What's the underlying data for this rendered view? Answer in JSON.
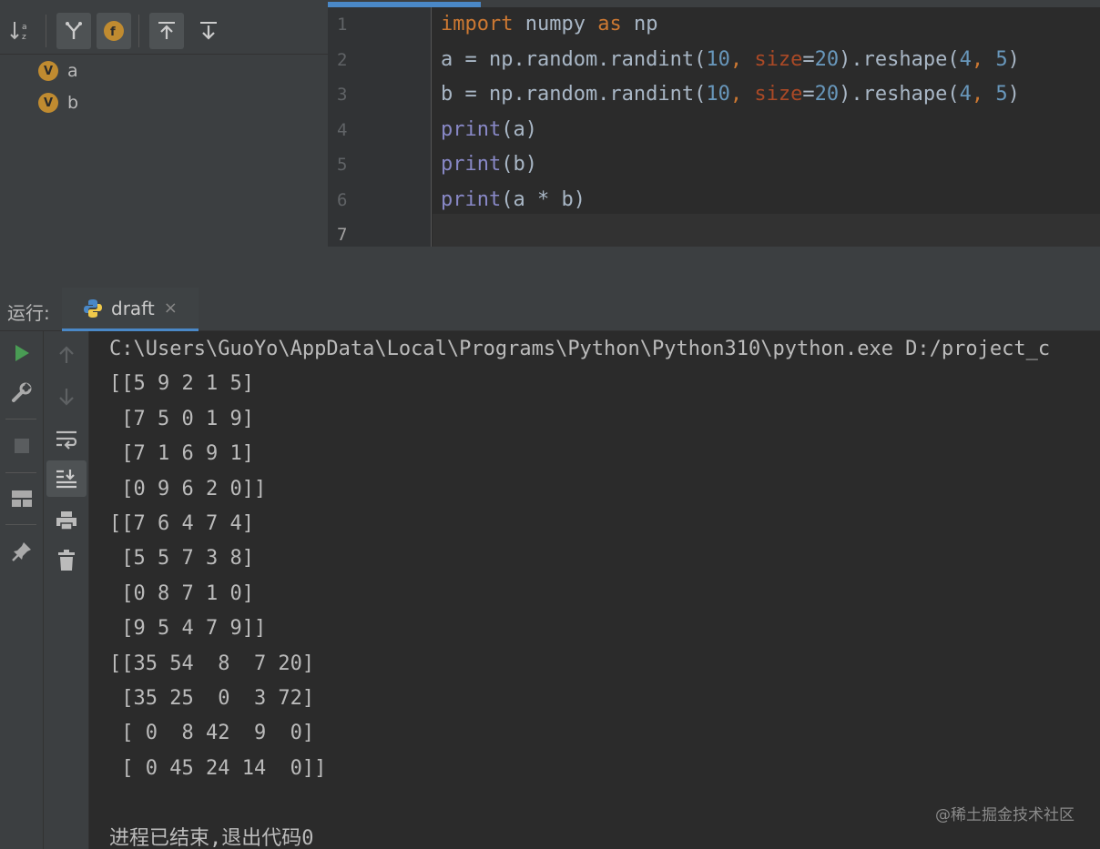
{
  "structure": {
    "toolbar_icons": [
      "sort-alpha-icon",
      "show-inherited-icon",
      "show-fields-icon",
      "expand-all-icon",
      "collapse-all-icon"
    ],
    "items": [
      {
        "badge": "V",
        "name": "a"
      },
      {
        "badge": "V",
        "name": "b"
      }
    ]
  },
  "editor": {
    "line_numbers": [
      "1",
      "2",
      "3",
      "4",
      "5",
      "6",
      "7"
    ],
    "lines": [
      [
        {
          "t": "import",
          "c": "kw"
        },
        {
          "t": " numpy ",
          "c": ""
        },
        {
          "t": "as",
          "c": "kw"
        },
        {
          "t": " np",
          "c": ""
        }
      ],
      [
        {
          "t": "a = np.random.randint(",
          "c": ""
        },
        {
          "t": "10",
          "c": "num"
        },
        {
          "t": ", ",
          "c": "kw"
        },
        {
          "t": "size",
          "c": "param"
        },
        {
          "t": "=",
          "c": ""
        },
        {
          "t": "20",
          "c": "num"
        },
        {
          "t": ").reshape(",
          "c": ""
        },
        {
          "t": "4",
          "c": "num"
        },
        {
          "t": ", ",
          "c": "kw"
        },
        {
          "t": "5",
          "c": "num"
        },
        {
          "t": ")",
          "c": ""
        }
      ],
      [
        {
          "t": "b = np.random.randint(",
          "c": ""
        },
        {
          "t": "10",
          "c": "num"
        },
        {
          "t": ", ",
          "c": "kw"
        },
        {
          "t": "size",
          "c": "param"
        },
        {
          "t": "=",
          "c": ""
        },
        {
          "t": "20",
          "c": "num"
        },
        {
          "t": ").reshape(",
          "c": ""
        },
        {
          "t": "4",
          "c": "num"
        },
        {
          "t": ", ",
          "c": "kw"
        },
        {
          "t": "5",
          "c": "num"
        },
        {
          "t": ")",
          "c": ""
        }
      ],
      [
        {
          "t": "print",
          "c": "fn"
        },
        {
          "t": "(a)",
          "c": ""
        }
      ],
      [
        {
          "t": "print",
          "c": "fn"
        },
        {
          "t": "(b)",
          "c": ""
        }
      ],
      [
        {
          "t": "print",
          "c": "fn"
        },
        {
          "t": "(a * b)",
          "c": ""
        }
      ],
      []
    ],
    "current_line": 7
  },
  "run": {
    "label": "运行:",
    "tab_name": "draft",
    "tab_close": "×",
    "left_toolbar": [
      "run-icon",
      "wrench-icon",
      "stop-icon",
      "layout-icon",
      "pin-icon"
    ],
    "second_toolbar": [
      "up-arrow-icon",
      "down-arrow-icon",
      "soft-wrap-icon",
      "scroll-to-end-icon",
      "print-icon",
      "trash-icon"
    ]
  },
  "console": {
    "lines": [
      "C:\\Users\\GuoYo\\AppData\\Local\\Programs\\Python\\Python310\\python.exe D:/project_c",
      "[[5 9 2 1 5]",
      " [7 5 0 1 9]",
      " [7 1 6 9 1]",
      " [0 9 6 2 0]]",
      "[[7 6 4 7 4]",
      " [5 5 7 3 8]",
      " [0 8 7 1 0]",
      " [9 5 4 7 9]]",
      "[[35 54  8  7 20]",
      " [35 25  0  3 72]",
      " [ 0  8 42  9  0]",
      " [ 0 45 24 14  0]]",
      "",
      "进程已结束,退出代码0"
    ],
    "watermark": "@稀土掘金技术社区"
  }
}
